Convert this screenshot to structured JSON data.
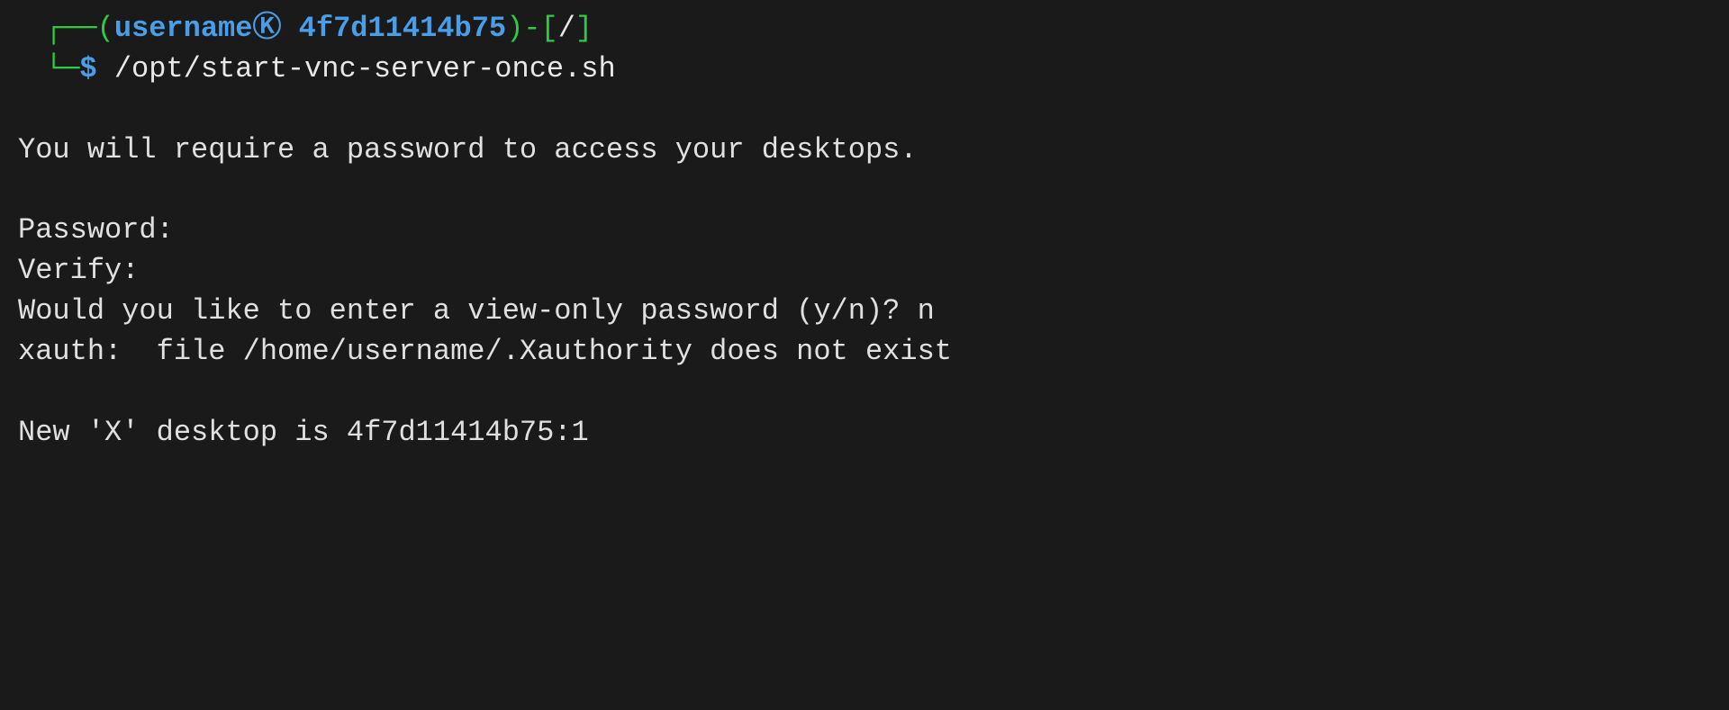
{
  "prompt": {
    "box_top": "┌──",
    "box_bottom": "└─",
    "open_paren": "(",
    "username": "username",
    "k_symbol": "Ⓚ",
    "hostname": "4f7d11414b75",
    "close_paren": ")",
    "dash": "-",
    "open_bracket": "[",
    "cwd": "/",
    "close_bracket": "]",
    "dollar": "$",
    "command": "/opt/start-vnc-server-once.sh"
  },
  "output": {
    "line1": "You will require a password to access your desktops.",
    "line2": "Password:",
    "line3": "Verify:",
    "line4": "Would you like to enter a view-only password (y/n)? n",
    "line5": "xauth:  file /home/username/.Xauthority does not exist",
    "line6": "New 'X' desktop is 4f7d11414b75:1"
  }
}
